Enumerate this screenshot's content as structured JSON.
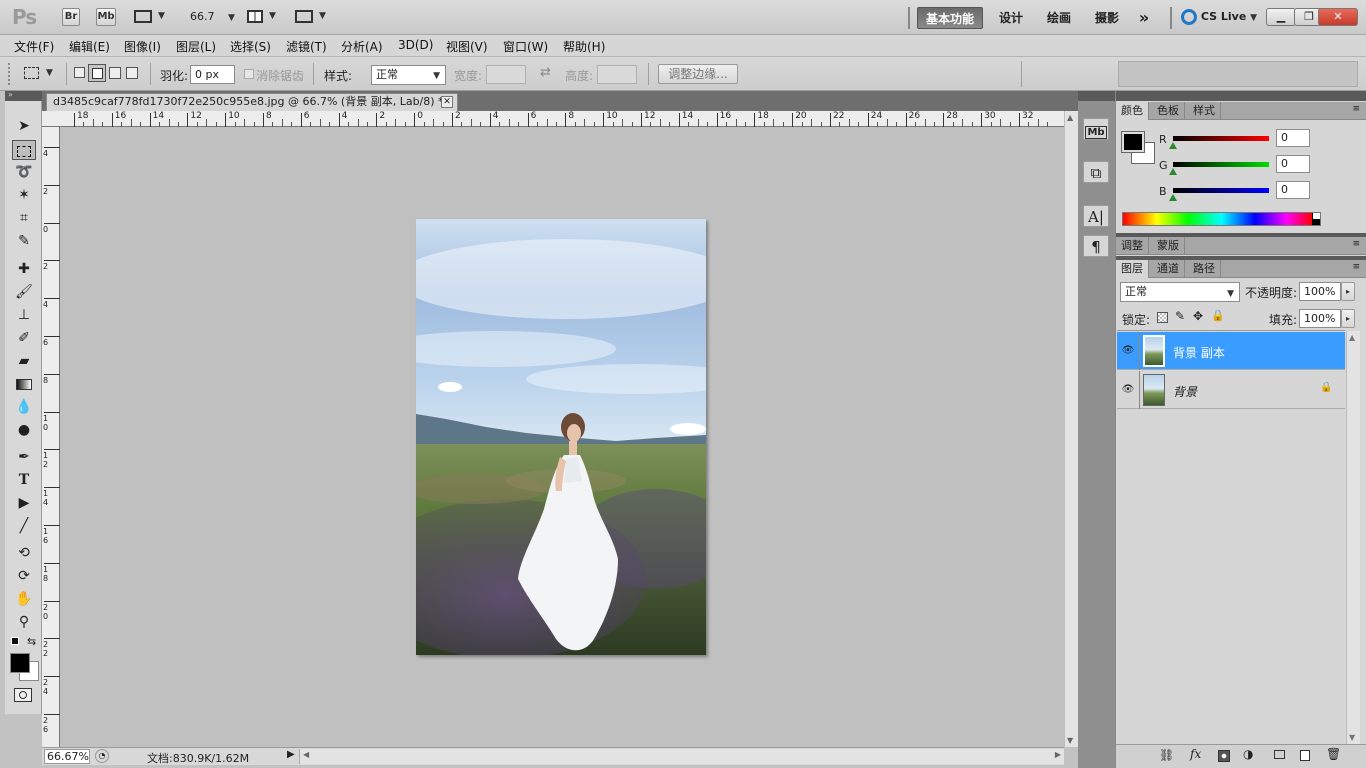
{
  "appbar": {
    "logo": "Ps",
    "bridge": "Br",
    "minibridge": "Mb",
    "zoom_value": "66.7",
    "workspaces": [
      "基本功能",
      "设计",
      "绘画",
      "摄影"
    ],
    "overflow": "»",
    "cslive": "CS Live",
    "window_buttons": [
      "minimize",
      "restore",
      "close"
    ]
  },
  "menus": [
    "文件(F)",
    "编辑(E)",
    "图像(I)",
    "图层(L)",
    "选择(S)",
    "滤镜(T)",
    "分析(A)",
    "3D(D)",
    "视图(V)",
    "窗口(W)",
    "帮助(H)"
  ],
  "options": {
    "feather_label": "羽化:",
    "feather_value": "0 px",
    "antialias_label": "消除锯齿",
    "style_label": "样式:",
    "style_value": "正常",
    "width_label": "宽度:",
    "height_label": "高度:",
    "refine_button": "调整边缘..."
  },
  "document": {
    "tab_title": "d3485c9caf778fd1730f72e250c955e8.jpg @ 66.7% (背景 副本, Lab/8) *",
    "ruler_h_labels": [
      "18",
      "16",
      "14",
      "12",
      "10",
      "8",
      "6",
      "4",
      "2",
      "0",
      "2",
      "4",
      "6",
      "8",
      "10",
      "12",
      "14",
      "16",
      "18",
      "20",
      "22",
      "24",
      "26",
      "28",
      "30",
      "32"
    ],
    "ruler_v_labels": [
      "4",
      "2",
      "0",
      "2",
      "4",
      "6",
      "8",
      "10",
      "12",
      "14",
      "16",
      "18",
      "20",
      "22",
      "24",
      "26"
    ]
  },
  "status": {
    "zoom": "66.67%",
    "doc_info": "文档:830.9K/1.62M"
  },
  "color_panel": {
    "tabs": [
      "颜色",
      "色板",
      "样式"
    ],
    "channels": [
      {
        "label": "R",
        "value": "0"
      },
      {
        "label": "G",
        "value": "0"
      },
      {
        "label": "B",
        "value": "0"
      }
    ]
  },
  "adjust_panel": {
    "tabs": [
      "调整",
      "蒙版"
    ]
  },
  "layers_panel": {
    "tabs": [
      "图层",
      "通道",
      "路径"
    ],
    "blend_mode": "正常",
    "opacity_label": "不透明度:",
    "opacity_value": "100%",
    "lock_label": "锁定:",
    "fill_label": "填充:",
    "fill_value": "100%",
    "layers": [
      {
        "name": "背景 副本",
        "selected": true,
        "locked": false
      },
      {
        "name": "背景",
        "selected": false,
        "locked": true
      }
    ]
  },
  "colors": {
    "accent_selected_layer": "#3b9cff",
    "foreground": "#000000",
    "background": "#ffffff"
  }
}
